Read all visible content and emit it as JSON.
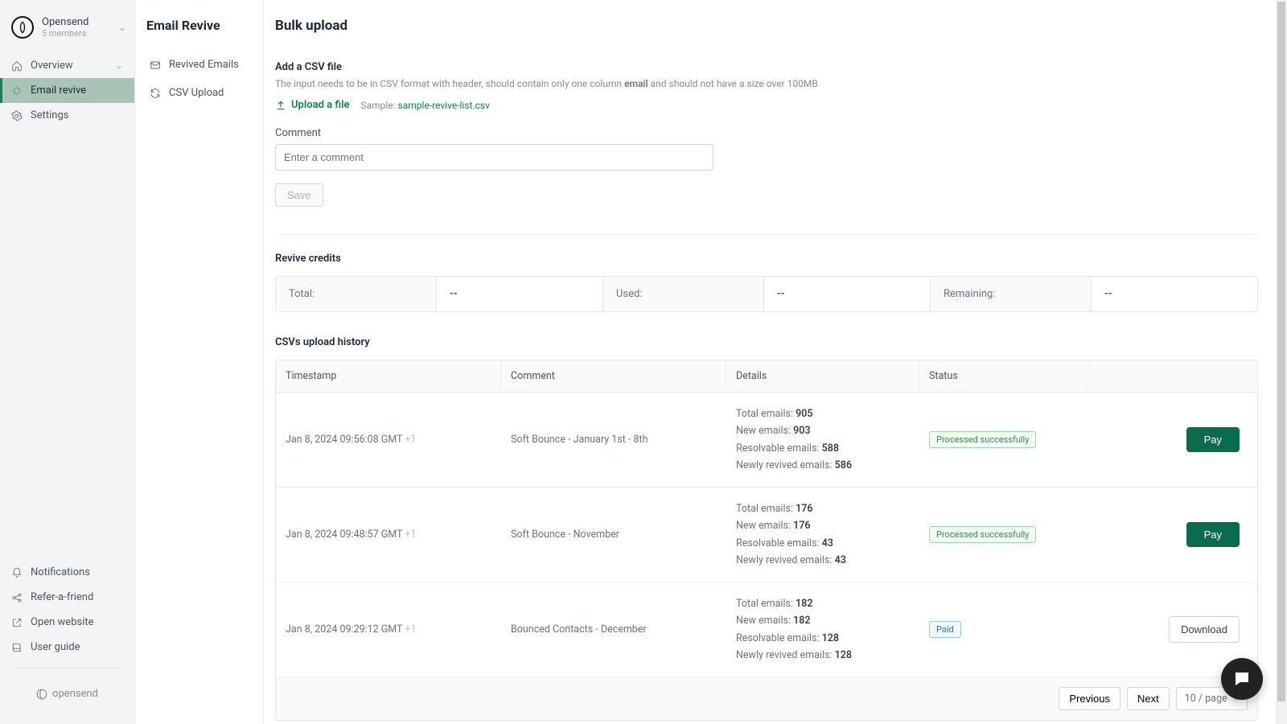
{
  "org": {
    "name": "Opensend",
    "sub": "5 members"
  },
  "sidebar": {
    "nav": [
      {
        "label": "Overview",
        "icon": "home",
        "expandable": true
      },
      {
        "label": "Email revive",
        "icon": "sparkle",
        "active": true
      },
      {
        "label": "Settings",
        "icon": "gear"
      }
    ],
    "bottom": [
      {
        "label": "Notifications",
        "icon": "bell"
      },
      {
        "label": "Refer-a-friend",
        "icon": "share"
      },
      {
        "label": "Open website",
        "icon": "external"
      },
      {
        "label": "User guide",
        "icon": "book"
      }
    ],
    "brand": "opensend"
  },
  "subcol": {
    "title": "Email Revive",
    "items": [
      {
        "label": "Revived Emails",
        "icon": "inbox"
      },
      {
        "label": "CSV Upload",
        "icon": "refresh"
      }
    ]
  },
  "main": {
    "title": "Bulk upload",
    "csv": {
      "label": "Add a CSV file",
      "hint_pre": "The input needs to be in CSV format with header, should contain only one column ",
      "hint_bold": "email",
      "hint_post": " and should not have a size over 100MB",
      "upload": "Upload a file",
      "sample_lbl": "Sample: ",
      "sample_link": "sample-revive-list.csv"
    },
    "comment": {
      "label": "Comment",
      "placeholder": "Enter a comment"
    },
    "save": "Save",
    "credits": {
      "title": "Revive credits",
      "cells": [
        {
          "label": "Total:",
          "value": "--"
        },
        {
          "label": "Used:",
          "value": "--"
        },
        {
          "label": "Remaining:",
          "value": "--"
        }
      ]
    },
    "history": {
      "title": "CSVs upload history",
      "cols": {
        "ts": "Timestamp",
        "cm": "Comment",
        "dt": "Details",
        "st": "Status"
      },
      "details_labels": {
        "total": "Total emails: ",
        "new": "New emails: ",
        "resolvable": "Resolvable emails: ",
        "revived": "Newly revived emails: "
      },
      "status_labels": {
        "ok": "Processed successfully",
        "paid": "Paid"
      },
      "actions": {
        "pay": "Pay",
        "download": "Download"
      },
      "rows": [
        {
          "ts": "Jan 8, 2024 09:56:08 GMT ",
          "tz": "+1",
          "cm": "Soft Bounce - January 1st - 8th",
          "det": {
            "total": "905",
            "new": "903",
            "resolvable": "588",
            "revived": "586"
          },
          "status": "ok",
          "action": "pay"
        },
        {
          "ts": "Jan 8, 2024 09:48:57 GMT ",
          "tz": "+1",
          "cm": "Soft Bounce - November",
          "det": {
            "total": "176",
            "new": "176",
            "resolvable": "43",
            "revived": "43"
          },
          "status": "ok",
          "action": "pay"
        },
        {
          "ts": "Jan 8, 2024 09:29:12 GMT ",
          "tz": "+1",
          "cm": "Bounced Contacts - December",
          "det": {
            "total": "182",
            "new": "182",
            "resolvable": "128",
            "revived": "128"
          },
          "status": "paid",
          "action": "download"
        }
      ],
      "pager": {
        "prev": "Previous",
        "next": "Next",
        "per": "10 / page"
      }
    }
  }
}
